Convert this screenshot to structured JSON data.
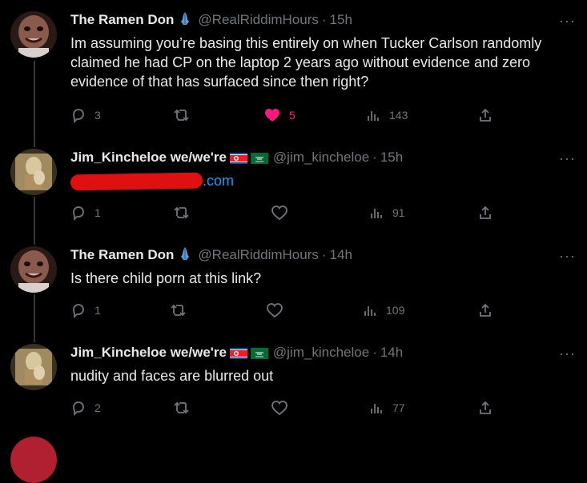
{
  "tweets": [
    {
      "name": "The Ramen Don",
      "handle": "@RealRiddimHours",
      "time": "15h",
      "text": "Im assuming you’re basing this entirely on when Tucker Carlson randomly claimed he had CP on the laptop 2 years ago without evidence and zero evidence of that has surfaced since then right?",
      "replies": "3",
      "retweets": "",
      "likes": "5",
      "views": "143",
      "liked": true,
      "badge_icon": "praying-hands-icon"
    },
    {
      "name": "Jim_Kincheloe we/we're",
      "handle": "@jim_kincheloe",
      "time": "15h",
      "link_suffix": ".com",
      "replies": "1",
      "retweets": "",
      "likes": "",
      "views": "91",
      "liked": false,
      "flags": [
        "north-korea-flag-icon",
        "saudi-arabia-flag-icon"
      ]
    },
    {
      "name": "The Ramen Don",
      "handle": "@RealRiddimHours",
      "time": "14h",
      "text": "Is there child porn at this link?",
      "replies": "1",
      "retweets": "",
      "likes": "",
      "views": "109",
      "liked": false,
      "badge_icon": "praying-hands-icon"
    },
    {
      "name": "Jim_Kincheloe we/we're",
      "handle": "@jim_kincheloe",
      "time": "14h",
      "text": "nudity and faces are blurred out",
      "replies": "2",
      "retweets": "",
      "likes": "",
      "views": "77",
      "liked": false,
      "flags": [
        "north-korea-flag-icon",
        "saudi-arabia-flag-icon"
      ]
    }
  ],
  "separator": "·",
  "more_glyph": "···",
  "colors": {
    "background": "#000000",
    "text": "#e7e9ea",
    "muted": "#71767b",
    "link": "#1d9bf0",
    "like": "#f91880",
    "redaction": "#e01010"
  }
}
